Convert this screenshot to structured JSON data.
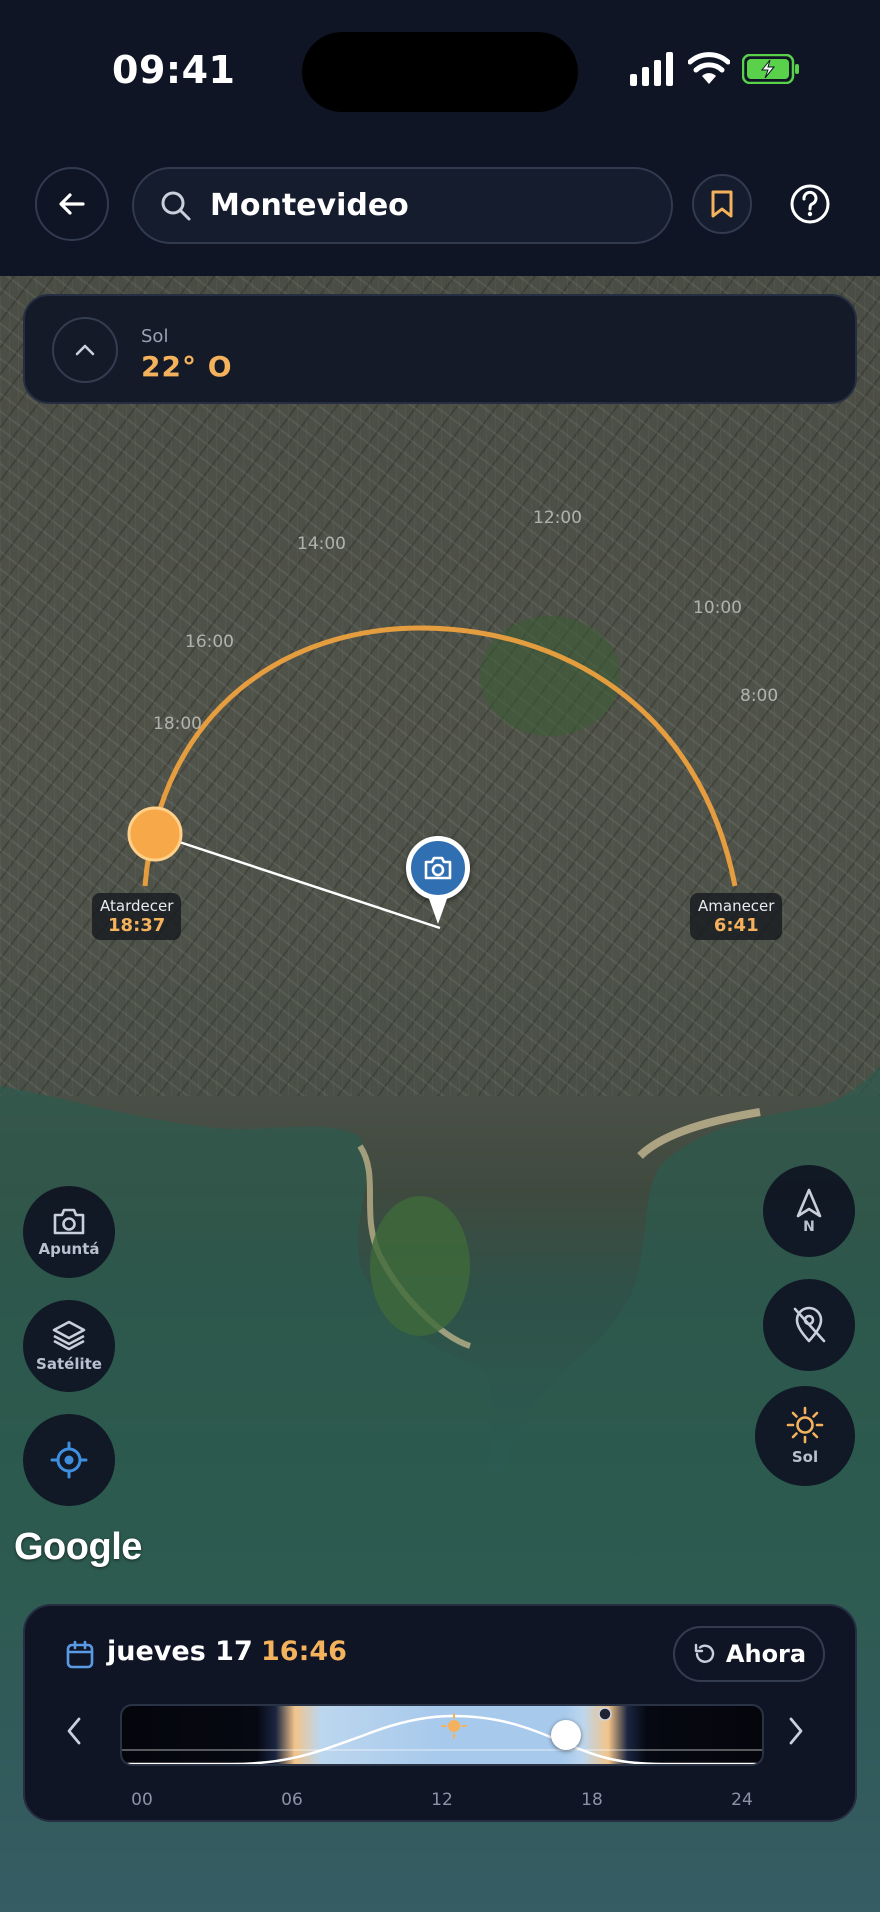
{
  "status_bar": {
    "time": "09:41"
  },
  "header": {
    "search_value": "Montevideo",
    "icons": {
      "back": "arrow-left-icon",
      "search": "search-icon",
      "bookmark": "bookmark-icon",
      "help": "help-icon"
    }
  },
  "sun_card": {
    "label": "Sol",
    "value": "22° O"
  },
  "map": {
    "hour_labels": [
      "12:00",
      "14:00",
      "10:00",
      "16:00",
      "8:00",
      "18:00"
    ],
    "sunset": {
      "label": "Atardecer",
      "time": "18:37"
    },
    "sunrise": {
      "label": "Amanecer",
      "time": "6:41"
    },
    "attribution": "Google"
  },
  "left_controls": [
    {
      "icon": "camera-icon",
      "label": "Apuntá"
    },
    {
      "icon": "layers-icon",
      "label": "Satélite"
    },
    {
      "icon": "locate-icon",
      "label": ""
    }
  ],
  "right_controls": [
    {
      "icon": "compass-north-icon",
      "label": "N"
    },
    {
      "icon": "location-off-icon",
      "label": ""
    },
    {
      "icon": "sun-icon",
      "label": "Sol"
    }
  ],
  "bottom_panel": {
    "date": "jueves 17",
    "time": "16:46",
    "now_button": "Ahora",
    "timeline_ticks": [
      "00",
      "06",
      "12",
      "18",
      "24"
    ],
    "current_hour_fraction": 0.698
  },
  "colors": {
    "accent": "#f5b25d",
    "panel": "#0f1525",
    "pin": "#2f6fb2"
  }
}
